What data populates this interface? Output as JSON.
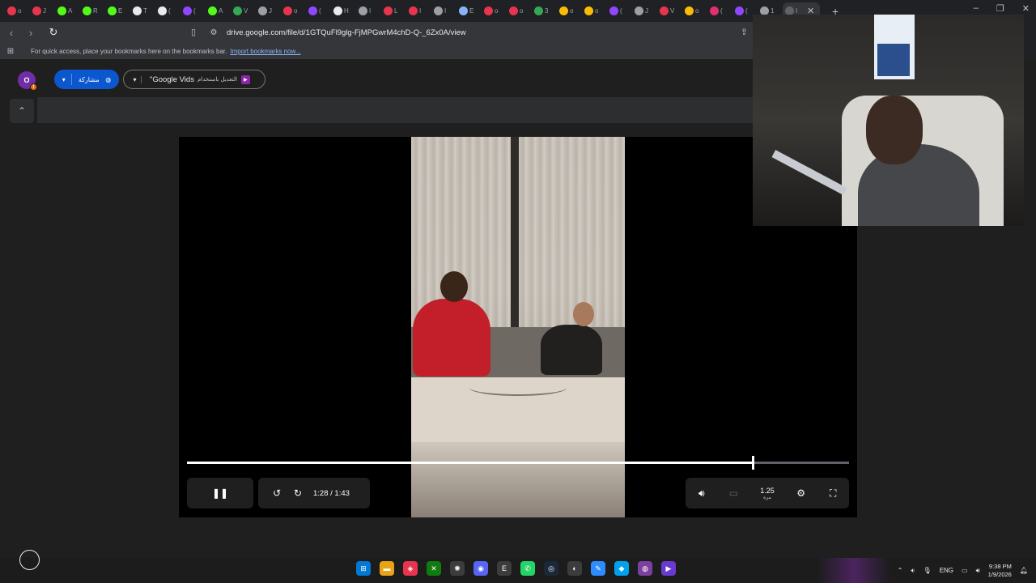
{
  "browser": {
    "tabs": [
      {
        "title": "o",
        "color": "#e8344e"
      },
      {
        "title": "J",
        "color": "#e8344e"
      },
      {
        "title": "A",
        "color": "#53fc18"
      },
      {
        "title": "R",
        "color": "#53fc18"
      },
      {
        "title": "E",
        "color": "#53fc18"
      },
      {
        "title": "T",
        "color": "#e8eaed"
      },
      {
        "title": "(",
        "color": "#e8eaed"
      },
      {
        "title": "(",
        "color": "#9146ff"
      },
      {
        "title": "A",
        "color": "#53fc18"
      },
      {
        "title": "V",
        "color": "#34a853"
      },
      {
        "title": "J",
        "color": "#9aa0a6"
      },
      {
        "title": "o",
        "color": "#e8344e"
      },
      {
        "title": "(",
        "color": "#9146ff"
      },
      {
        "title": "H",
        "color": "#e8eaed"
      },
      {
        "title": "I",
        "color": "#9aa0a6"
      },
      {
        "title": "L",
        "color": "#e8344e"
      },
      {
        "title": "I",
        "color": "#e8344e"
      },
      {
        "title": "I",
        "color": "#9aa0a6"
      },
      {
        "title": "E",
        "color": "#8ab4f8"
      },
      {
        "title": "o",
        "color": "#e8344e"
      },
      {
        "title": "o",
        "color": "#e8344e"
      },
      {
        "title": "3",
        "color": "#34a853"
      },
      {
        "title": "o",
        "color": "#fbbc04"
      },
      {
        "title": "o",
        "color": "#fbbc04"
      },
      {
        "title": "(",
        "color": "#9146ff"
      },
      {
        "title": "J",
        "color": "#9aa0a6"
      },
      {
        "title": "V",
        "color": "#e8344e"
      },
      {
        "title": "o",
        "color": "#fbbc04"
      },
      {
        "title": "(",
        "color": "#e1306c"
      },
      {
        "title": "(",
        "color": "#9146ff"
      },
      {
        "title": "1",
        "color": "#9aa0a6"
      }
    ],
    "active_tab_title": "I",
    "new_tab": "+",
    "window_controls": [
      "–",
      "❐",
      "✕"
    ],
    "url": "drive.google.com/file/d/1GTQuFl9glg-FjMPGwrM4chD-Q-_6Zx0A/view",
    "bookmarks_message": "For quick access, place your bookmarks here on the bookmarks bar.",
    "bookmarks_link": "Import bookmarks now..."
  },
  "drive": {
    "avatar_letter": "O",
    "avatar_badge": "!",
    "share_label": "مشاركة",
    "vids_label": "\"Google Vids",
    "vids_arabic": "التعديل باستخدام"
  },
  "player": {
    "time_current": "1:28",
    "time_total": "1:43",
    "progress_fraction": 0.854,
    "speed_value": "1.25",
    "speed_label": "مرة"
  },
  "taskbar": {
    "lang": "ENG",
    "time": "9:38 PM",
    "date": "1/9/2026"
  }
}
